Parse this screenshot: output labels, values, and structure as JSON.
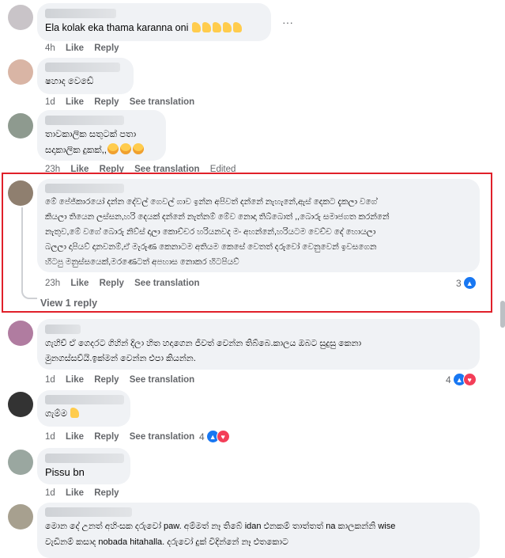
{
  "comments": [
    {
      "text": [
        "Ela kolak eka thama karanna oni"
      ],
      "time": "4h",
      "like": "Like",
      "reply": "Reply",
      "more": "···"
    },
    {
      "text": [
        "ෂහාද වෙඩේ"
      ],
      "time": "1d",
      "like": "Like",
      "reply": "Reply",
      "see_translation": "See translation"
    },
    {
      "text": [
        "තාවකාලික සතුටක් පතා",
        "සදාකාලික දුකක්,,"
      ],
      "time": "23h",
      "like": "Like",
      "reply": "Reply",
      "see_translation": "See translation",
      "edited": "Edited"
    },
    {
      "text": [
        "මේ පේජ්කාරයෝ දන්න දේවල් ගෙවල් ගාව ඉන්න අපිවත් දන්නේ නැහැනේ,ඇස් දෙකට දැකලා වගේ",
        "කියලා තියෙන ලස්සන,හරි දෙයක් දන්නේ නැත්නම් මේව නොදා තිබ්බොත් ,,බොරු සමාජගත කරන්නේ",
        "නැතුව,මේ වගේ බොරු නිව්ස් දාලා කොච්චර හරියනවද මං අහන්නේ,හරියටම වෙච්ච දේ හොයලා",
        "බලලා දාපියව් දානවනම්,ඒ මැරුණ කෙනාටම අතියම කෙසේ වෙතත් දරුවෝ වෙනුවෙන් ඉවසගෙන",
        "හිටපු මනුස්සයෙක්,මරණෙටත් අපහාස නොකර හිටපියව්"
      ],
      "time": "23h",
      "like": "Like",
      "reply": "Reply",
      "see_translation": "See translation",
      "reactions": "3",
      "view_replies": "View 1 reply"
    },
    {
      "text": [
        "ගැහිච් ඒ ගෙදරට ගිහින් දිලා හිත හදාගෙන ජිවත් වෙන්න තිබ්බෙ.කාලය ඔබට සුදුසු කෙනා",
        "මුනගස්සව්යි.ඉක්මන් වෙන්න එපා කියන්න."
      ],
      "time": "1d",
      "like": "Like",
      "reply": "Reply",
      "see_translation": "See translation",
      "reactions": "4"
    },
    {
      "text": [
        "ගැම්ම"
      ],
      "time": "1d",
      "like": "Like",
      "reply": "Reply",
      "see_translation": "See translation",
      "reactions": "4"
    },
    {
      "text": [
        "Pissu bn"
      ],
      "time": "1d",
      "like": "Like",
      "reply": "Reply"
    },
    {
      "text": [
        "මොන දේ උනත් අහිංසක දරුවෝ paw. අම්මත් නෑ තිබේ idan එනකම් තාත්තත් na කාලකන්නි wise",
        "වැඩිනම් කසාද nobada hitahalla. දරුවෝ දුක් විදින්නේ නෑ එතකොට"
      ]
    }
  ],
  "colors": {
    "accent": "#1877f2",
    "love": "#f33e58",
    "highlight": "#e0202a"
  },
  "icons": [
    "thumbs-up-emoji",
    "crying-face-emoji",
    "like-reaction-icon",
    "love-reaction-icon",
    "more-options-icon"
  ]
}
